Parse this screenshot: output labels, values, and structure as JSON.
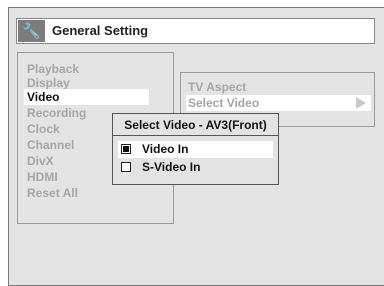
{
  "title": {
    "text": "General Setting",
    "icon": "wrench-icon"
  },
  "menu": {
    "items": [
      {
        "label": "Playback",
        "active": false
      },
      {
        "label": "Display",
        "active": false
      },
      {
        "label": "Video",
        "active": true
      },
      {
        "label": "Recording",
        "active": false
      },
      {
        "label": "Clock",
        "active": false
      },
      {
        "label": "Channel",
        "active": false
      },
      {
        "label": "DivX",
        "active": false
      },
      {
        "label": "HDMI",
        "active": false
      },
      {
        "label": "Reset All",
        "active": false
      }
    ]
  },
  "submenu": {
    "items": [
      {
        "label": "TV Aspect"
      },
      {
        "label": "Select Video"
      }
    ]
  },
  "popup": {
    "title": "Select Video - AV3(Front)",
    "options": [
      {
        "label": "Video In",
        "checked": true
      },
      {
        "label": "S-Video In",
        "checked": false
      }
    ]
  }
}
